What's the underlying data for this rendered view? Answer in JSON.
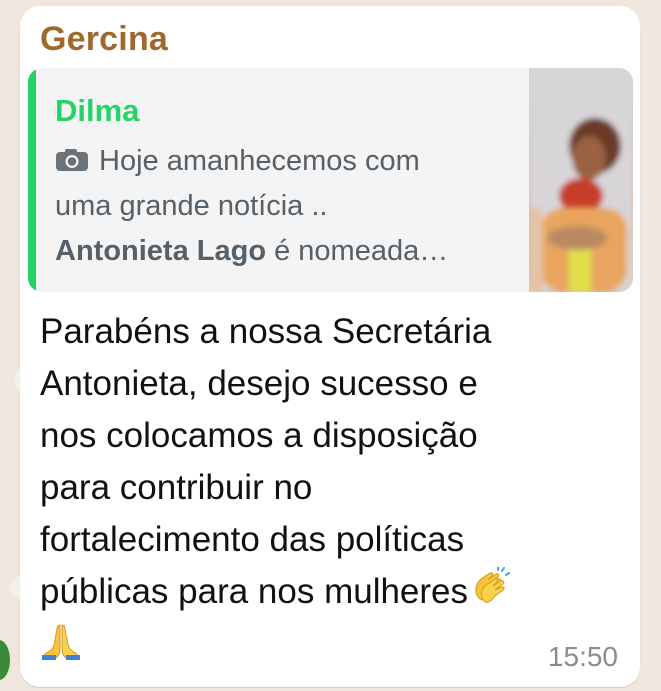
{
  "chat": {
    "sender_name": "Gercina",
    "quoted": {
      "author": "Dilma",
      "line1": "Hoje amanhecemos com",
      "line2": "uma grande notícia ..",
      "line3_bold": "Antonieta Lago",
      "line3_rest": " é  nomeada…",
      "icon": "camera-icon"
    },
    "message_lines": [
      "Parabéns a nossa Secretária",
      "Antonieta, desejo sucesso e",
      "nos colocamos a disposição",
      "para contribuir no",
      "fortalecimento das políticas",
      "públicas para nos mulheres"
    ],
    "emojis": [
      "clapping-hands-emoji",
      "folded-hands-emoji"
    ],
    "time": "15:50"
  },
  "colors": {
    "sender": "#a0692c",
    "quote_author": "#25d366",
    "quote_bar": "#25d366",
    "bubble": "#ffffff",
    "background": "#efe7dd"
  }
}
